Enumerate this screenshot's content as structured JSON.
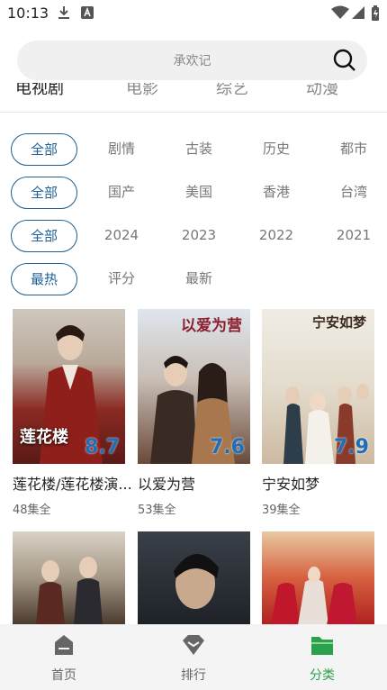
{
  "status": {
    "time": "10:13"
  },
  "search": {
    "placeholder": "承欢记"
  },
  "top_tabs": [
    "电视剧",
    "电影",
    "综艺",
    "动漫"
  ],
  "filters": {
    "genre": [
      "全部",
      "剧情",
      "古装",
      "历史",
      "都市"
    ],
    "region": [
      "全部",
      "国产",
      "美国",
      "香港",
      "台湾"
    ],
    "year": [
      "全部",
      "2024",
      "2023",
      "2022",
      "2021"
    ],
    "sort": [
      "最热",
      "评分",
      "最新"
    ]
  },
  "items": [
    {
      "title": "莲花楼/莲花楼演...",
      "episodes": "48集全",
      "rating": "8.7",
      "poster_text": "莲花楼"
    },
    {
      "title": "以爱为营",
      "episodes": "53集全",
      "rating": "7.6",
      "poster_text": "以爱为营"
    },
    {
      "title": "宁安如梦",
      "episodes": "39集全",
      "rating": "7.9",
      "poster_text": "宁安如梦"
    }
  ],
  "nav": {
    "home": "首页",
    "rank": "排行",
    "category": "分类"
  },
  "colors": {
    "accent": "#1f5f93",
    "active_nav": "#2aa14a"
  }
}
